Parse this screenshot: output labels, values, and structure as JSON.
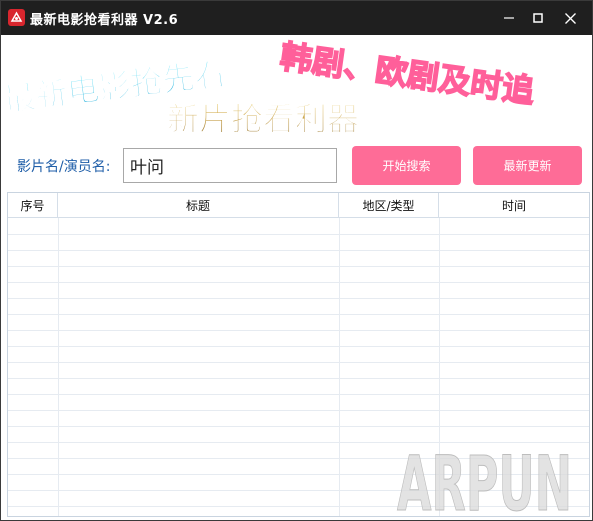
{
  "window": {
    "title": "最新电影抢看利器 V2.6"
  },
  "banner": {
    "line1": "最新电影抢先看",
    "line2": "韩剧、欧剧及时追",
    "line3": "新片抢看利器"
  },
  "search": {
    "label": "影片名/演员名:",
    "value": "叶问"
  },
  "buttons": {
    "search": "开始搜索",
    "update": "最新更新"
  },
  "table": {
    "columns": [
      "序号",
      "标题",
      "地区/类型",
      "时间"
    ],
    "rows": []
  },
  "watermark": {
    "text": "ARPUN"
  }
}
